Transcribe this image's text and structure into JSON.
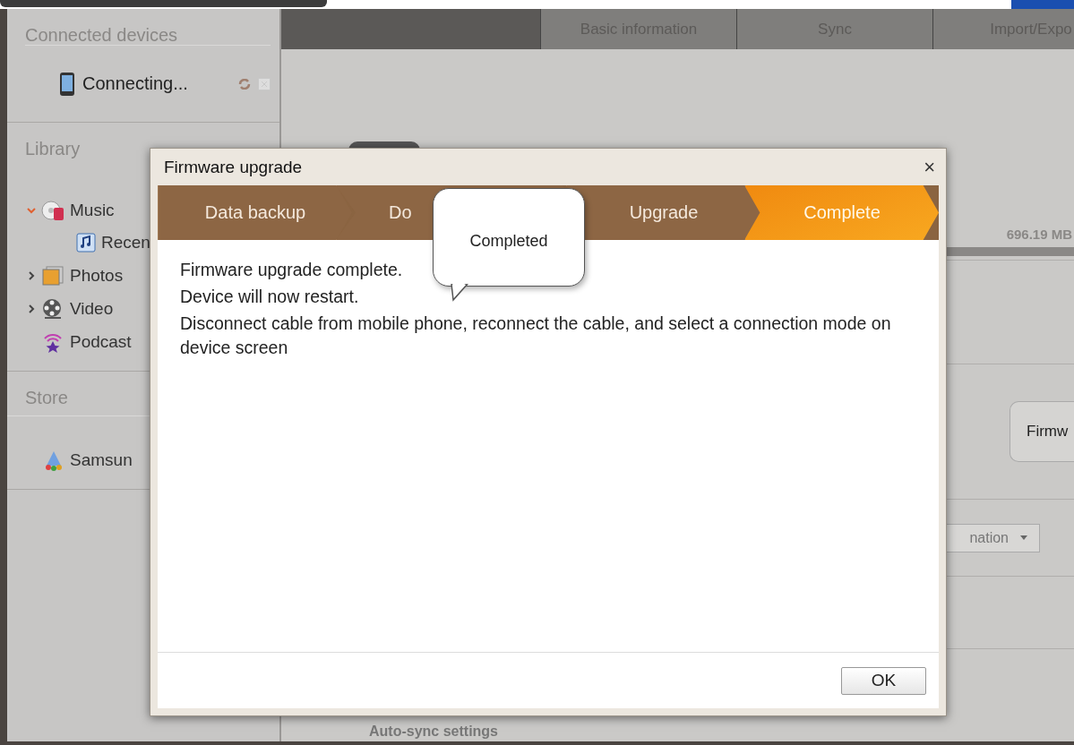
{
  "sidebar": {
    "connected_header": "Connected devices",
    "device": {
      "label": "Connecting..."
    },
    "library_header": "Library",
    "library": [
      {
        "label": "Music",
        "kind": "music",
        "expanded": true,
        "children": [
          {
            "label": "Recen",
            "kind": "note"
          }
        ]
      },
      {
        "label": "Photos",
        "kind": "photos",
        "expanded": false
      },
      {
        "label": "Video",
        "kind": "video",
        "expanded": false
      },
      {
        "label": "Podcast",
        "kind": "podcast"
      }
    ],
    "store_header": "Store",
    "store": [
      {
        "label": "Samsun"
      }
    ]
  },
  "main": {
    "tabs": [
      {
        "label": "Basic information",
        "selected": false
      },
      {
        "label": "Sync",
        "selected": false
      },
      {
        "label": "Import/Expo",
        "selected": false
      }
    ],
    "storage": "696.19 MB",
    "firmware_button": "Firmw",
    "dropdown": "nation",
    "section_title": "Auto-sync settings"
  },
  "dialog": {
    "title": "Firmware upgrade",
    "close": "×",
    "steps": [
      {
        "label": "Data backup",
        "selected": false
      },
      {
        "label": "Do",
        "selected": false
      },
      {
        "label": "Upgrade",
        "selected": false
      },
      {
        "label": "Complete",
        "selected": true
      }
    ],
    "tooltip": "Completed",
    "lines": [
      "Firmware upgrade complete.",
      "Device will now restart.",
      "Disconnect cable from mobile phone, reconnect the cable, and select a connection mode on device screen"
    ],
    "ok": "OK"
  }
}
